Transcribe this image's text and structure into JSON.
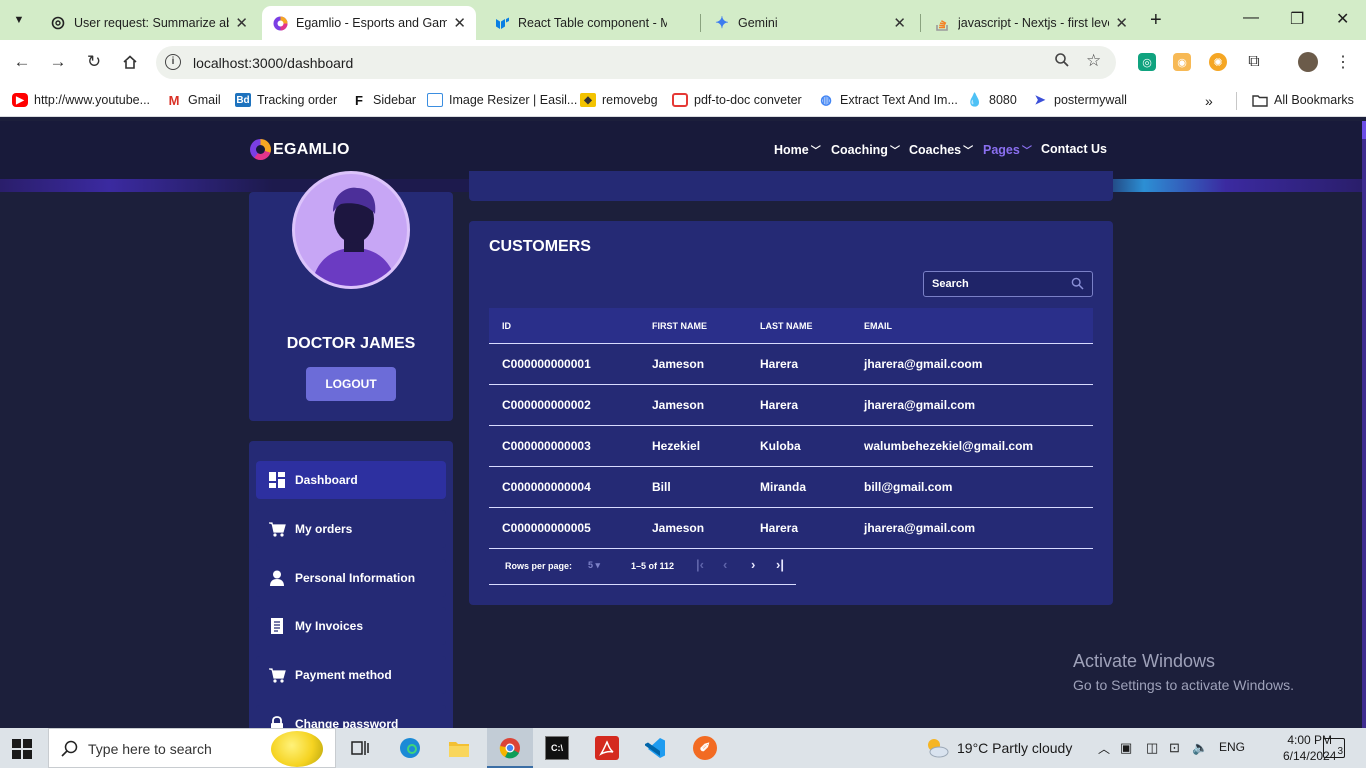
{
  "browser": {
    "tabs": [
      {
        "title": "User request: Summarize ab",
        "favicon": "openai-icon"
      },
      {
        "title": "Egamlio - Esports and Gaming",
        "favicon": "egamlio-icon"
      },
      {
        "title": "React Table component - Ma",
        "favicon": "mui-icon"
      },
      {
        "title": "Gemini",
        "favicon": "gemini-icon"
      },
      {
        "title": "javascript - Nextjs - first leve",
        "favicon": "stackoverflow-icon"
      }
    ],
    "url": "localhost:3000/dashboard",
    "bookmarks": [
      "http://www.youtube...",
      "Gmail",
      "Tracking order",
      "Sidebar",
      "Image Resizer | Easil...",
      "removebg",
      "pdf-to-doc conveter",
      "Extract Text And Im...",
      "8080",
      "postermywall"
    ],
    "all_bookmarks": "All Bookmarks",
    "colors": {
      "tabbar": "#d3ecc8",
      "accent": "#6c6cd8",
      "page_bg": "#1c1f3b",
      "card_bg": "#252a75"
    }
  },
  "site": {
    "logo": "EGAMLIO",
    "menu": [
      {
        "label": "Home",
        "has_dropdown": true
      },
      {
        "label": "Coaching",
        "has_dropdown": true
      },
      {
        "label": "Coaches",
        "has_dropdown": true
      },
      {
        "label": "Pages",
        "has_dropdown": true
      },
      {
        "label": "Contact Us",
        "has_dropdown": false
      }
    ]
  },
  "profile": {
    "name": "DOCTOR JAMES",
    "logout_label": "LOGOUT"
  },
  "sidebar": {
    "items": [
      {
        "label": "Dashboard",
        "icon": "dashboard-icon",
        "active": true
      },
      {
        "label": "My orders",
        "icon": "cart-icon"
      },
      {
        "label": "Personal Information",
        "icon": "user-icon"
      },
      {
        "label": "My Invoices",
        "icon": "invoice-icon"
      },
      {
        "label": "Payment method",
        "icon": "cart-icon"
      },
      {
        "label": "Change password",
        "icon": "lock-icon"
      }
    ]
  },
  "customers": {
    "title": "CUSTOMERS",
    "search_placeholder": "Search",
    "columns": [
      "ID",
      "FIRST NAME",
      "LAST NAME",
      "EMAIL"
    ],
    "rows": [
      [
        "C000000000001",
        "Jameson",
        "Harera",
        "jharera@gmail.coom"
      ],
      [
        "C000000000002",
        "Jameson",
        "Harera",
        "jharera@gmail.com"
      ],
      [
        "C000000000003",
        "Hezekiel",
        "Kuloba",
        "walumbehezekiel@gmail.com"
      ],
      [
        "C000000000004",
        "Bill",
        "Miranda",
        "bill@gmail.com"
      ],
      [
        "C000000000005",
        "Jameson",
        "Harera",
        "jharera@gmail.com"
      ]
    ],
    "pagination": {
      "rows_per_page_label": "Rows per page:",
      "rows_per_page": "5",
      "range": "1–5 of 112"
    }
  },
  "watermark": {
    "line1": "Activate Windows",
    "line2": "Go to Settings to activate Windows."
  },
  "taskbar": {
    "search_placeholder": "Type here to search",
    "weather": "19°C  Partly cloudy",
    "language": "ENG",
    "time": "4:00 PM",
    "date": "6/14/2024",
    "notifications": "3"
  }
}
